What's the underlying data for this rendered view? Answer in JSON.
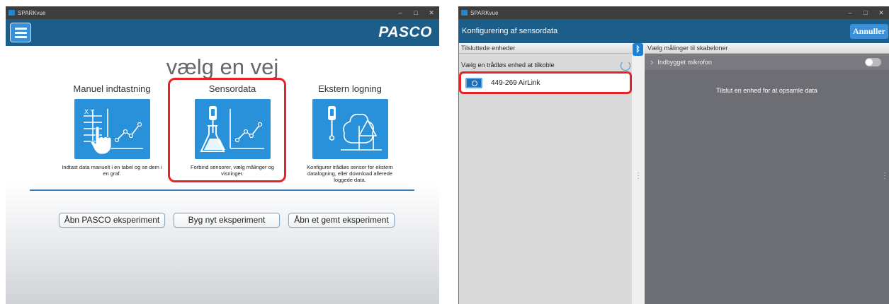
{
  "left_window": {
    "app_title": "SPARKvue",
    "controls": [
      "–",
      "□",
      "✕"
    ],
    "brand": "PASCO",
    "main_title": "vælg en vej",
    "cards": [
      {
        "title": "Manuel indtastning",
        "desc": "Indtast data manuelt i en tabel og se dem i en graf.",
        "icon": "table-graph-icon"
      },
      {
        "title": "Sensordata",
        "desc": "Forbind sensorer, vælg målinger og visninger.",
        "icon": "sensor-flask-icon"
      },
      {
        "title": "Ekstern logning",
        "desc": "Konfigurer trådløs sensor for ekstern datalogning, eller download allerede loggede data.",
        "icon": "remote-trees-icon"
      }
    ],
    "buttons": [
      "Åbn PASCO eksperiment",
      "Byg nyt eksperiment",
      "Åbn et gemt eksperiment"
    ]
  },
  "right_window": {
    "app_title": "SPARKvue",
    "controls": [
      "–",
      "□",
      "✕"
    ],
    "header_title": "Konfigurering af sensordata",
    "cancel_label": "Annuller",
    "left_panel": {
      "heading": "Tilsluttede enheder",
      "subheading": "Vælg en trådløs enhed at tilkoble",
      "device_name": "449-269  AirLink"
    },
    "right_panel": {
      "heading": "Vælg målinger til skabeloner",
      "mic_label": "Indbygget mikrofon",
      "mic_enabled": false,
      "empty_message": "Tilslut en enhed for at opsamle data"
    }
  },
  "colors": {
    "header_blue": "#1d5d8a",
    "tile_blue": "#2990da",
    "highlight_red": "#e5242a",
    "dark_panel": "#6d6d74"
  }
}
